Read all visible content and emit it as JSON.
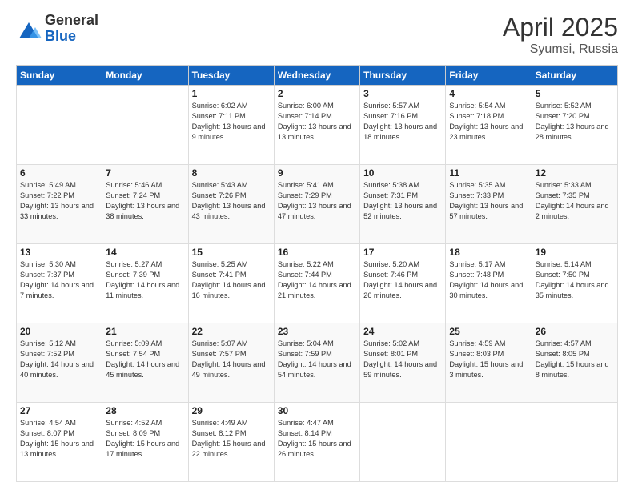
{
  "header": {
    "logo_general": "General",
    "logo_blue": "Blue",
    "month_title": "April 2025",
    "location": "Syumsi, Russia"
  },
  "days_of_week": [
    "Sunday",
    "Monday",
    "Tuesday",
    "Wednesday",
    "Thursday",
    "Friday",
    "Saturday"
  ],
  "weeks": [
    [
      {
        "day": "",
        "info": ""
      },
      {
        "day": "",
        "info": ""
      },
      {
        "day": "1",
        "info": "Sunrise: 6:02 AM\nSunset: 7:11 PM\nDaylight: 13 hours and 9 minutes."
      },
      {
        "day": "2",
        "info": "Sunrise: 6:00 AM\nSunset: 7:14 PM\nDaylight: 13 hours and 13 minutes."
      },
      {
        "day": "3",
        "info": "Sunrise: 5:57 AM\nSunset: 7:16 PM\nDaylight: 13 hours and 18 minutes."
      },
      {
        "day": "4",
        "info": "Sunrise: 5:54 AM\nSunset: 7:18 PM\nDaylight: 13 hours and 23 minutes."
      },
      {
        "day": "5",
        "info": "Sunrise: 5:52 AM\nSunset: 7:20 PM\nDaylight: 13 hours and 28 minutes."
      }
    ],
    [
      {
        "day": "6",
        "info": "Sunrise: 5:49 AM\nSunset: 7:22 PM\nDaylight: 13 hours and 33 minutes."
      },
      {
        "day": "7",
        "info": "Sunrise: 5:46 AM\nSunset: 7:24 PM\nDaylight: 13 hours and 38 minutes."
      },
      {
        "day": "8",
        "info": "Sunrise: 5:43 AM\nSunset: 7:26 PM\nDaylight: 13 hours and 43 minutes."
      },
      {
        "day": "9",
        "info": "Sunrise: 5:41 AM\nSunset: 7:29 PM\nDaylight: 13 hours and 47 minutes."
      },
      {
        "day": "10",
        "info": "Sunrise: 5:38 AM\nSunset: 7:31 PM\nDaylight: 13 hours and 52 minutes."
      },
      {
        "day": "11",
        "info": "Sunrise: 5:35 AM\nSunset: 7:33 PM\nDaylight: 13 hours and 57 minutes."
      },
      {
        "day": "12",
        "info": "Sunrise: 5:33 AM\nSunset: 7:35 PM\nDaylight: 14 hours and 2 minutes."
      }
    ],
    [
      {
        "day": "13",
        "info": "Sunrise: 5:30 AM\nSunset: 7:37 PM\nDaylight: 14 hours and 7 minutes."
      },
      {
        "day": "14",
        "info": "Sunrise: 5:27 AM\nSunset: 7:39 PM\nDaylight: 14 hours and 11 minutes."
      },
      {
        "day": "15",
        "info": "Sunrise: 5:25 AM\nSunset: 7:41 PM\nDaylight: 14 hours and 16 minutes."
      },
      {
        "day": "16",
        "info": "Sunrise: 5:22 AM\nSunset: 7:44 PM\nDaylight: 14 hours and 21 minutes."
      },
      {
        "day": "17",
        "info": "Sunrise: 5:20 AM\nSunset: 7:46 PM\nDaylight: 14 hours and 26 minutes."
      },
      {
        "day": "18",
        "info": "Sunrise: 5:17 AM\nSunset: 7:48 PM\nDaylight: 14 hours and 30 minutes."
      },
      {
        "day": "19",
        "info": "Sunrise: 5:14 AM\nSunset: 7:50 PM\nDaylight: 14 hours and 35 minutes."
      }
    ],
    [
      {
        "day": "20",
        "info": "Sunrise: 5:12 AM\nSunset: 7:52 PM\nDaylight: 14 hours and 40 minutes."
      },
      {
        "day": "21",
        "info": "Sunrise: 5:09 AM\nSunset: 7:54 PM\nDaylight: 14 hours and 45 minutes."
      },
      {
        "day": "22",
        "info": "Sunrise: 5:07 AM\nSunset: 7:57 PM\nDaylight: 14 hours and 49 minutes."
      },
      {
        "day": "23",
        "info": "Sunrise: 5:04 AM\nSunset: 7:59 PM\nDaylight: 14 hours and 54 minutes."
      },
      {
        "day": "24",
        "info": "Sunrise: 5:02 AM\nSunset: 8:01 PM\nDaylight: 14 hours and 59 minutes."
      },
      {
        "day": "25",
        "info": "Sunrise: 4:59 AM\nSunset: 8:03 PM\nDaylight: 15 hours and 3 minutes."
      },
      {
        "day": "26",
        "info": "Sunrise: 4:57 AM\nSunset: 8:05 PM\nDaylight: 15 hours and 8 minutes."
      }
    ],
    [
      {
        "day": "27",
        "info": "Sunrise: 4:54 AM\nSunset: 8:07 PM\nDaylight: 15 hours and 13 minutes."
      },
      {
        "day": "28",
        "info": "Sunrise: 4:52 AM\nSunset: 8:09 PM\nDaylight: 15 hours and 17 minutes."
      },
      {
        "day": "29",
        "info": "Sunrise: 4:49 AM\nSunset: 8:12 PM\nDaylight: 15 hours and 22 minutes."
      },
      {
        "day": "30",
        "info": "Sunrise: 4:47 AM\nSunset: 8:14 PM\nDaylight: 15 hours and 26 minutes."
      },
      {
        "day": "",
        "info": ""
      },
      {
        "day": "",
        "info": ""
      },
      {
        "day": "",
        "info": ""
      }
    ]
  ]
}
